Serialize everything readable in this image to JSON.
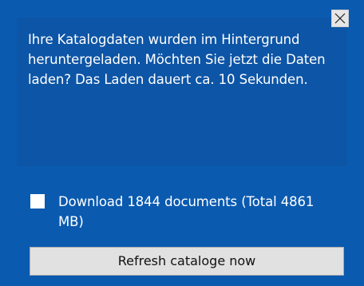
{
  "message": {
    "text": "Ihre Katalogdaten wurden im Hintergrund heruntergeladen. Möchten Sie jetzt die Daten laden? Das Laden dauert ca. 10 Sekunden."
  },
  "close_button": {
    "icon": "close-icon"
  },
  "download_option": {
    "checked": false,
    "label": "Download 1844 documents (Total 4861 MB)"
  },
  "refresh_button": {
    "label": "Refresh cataloge now"
  },
  "colors": {
    "background": "#0a5ab0",
    "message_box": "#0d55a6",
    "button_face": "#e1e1e1",
    "text": "#ffffff"
  }
}
